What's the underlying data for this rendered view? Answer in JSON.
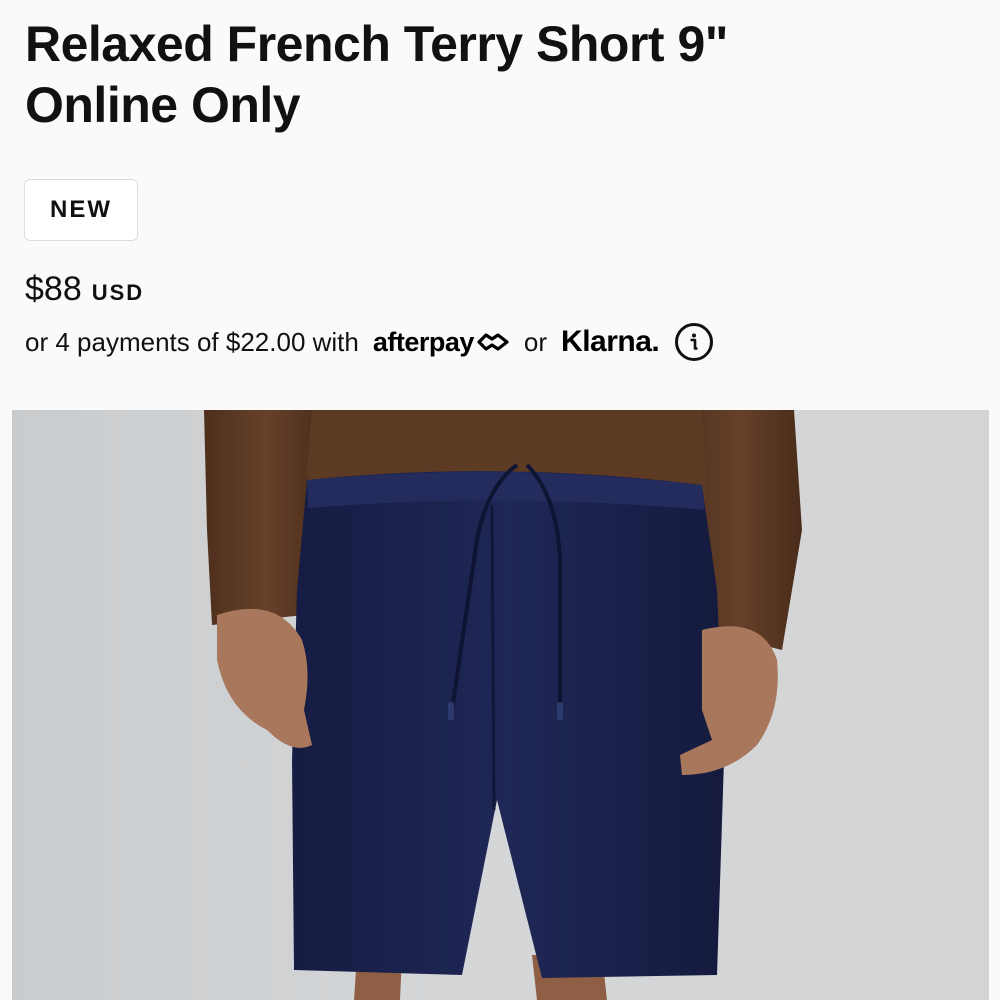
{
  "product": {
    "title_line1": "Relaxed French Terry Short 9\"",
    "title_line2": "Online Only",
    "badge": "NEW",
    "price": "$88",
    "currency": "USD"
  },
  "payments": {
    "prefix": "or 4 payments of $22.00 with",
    "afterpay_logo_text": "afterpay",
    "or_text": "or",
    "klarna_logo_text": "Klarna.",
    "info_icon": "info-icon"
  },
  "image": {
    "shirt_color": "#5a3721",
    "shorts_color": "#1c2350",
    "skin_color": "#a9785c",
    "background_color": "#cfd1d3"
  }
}
